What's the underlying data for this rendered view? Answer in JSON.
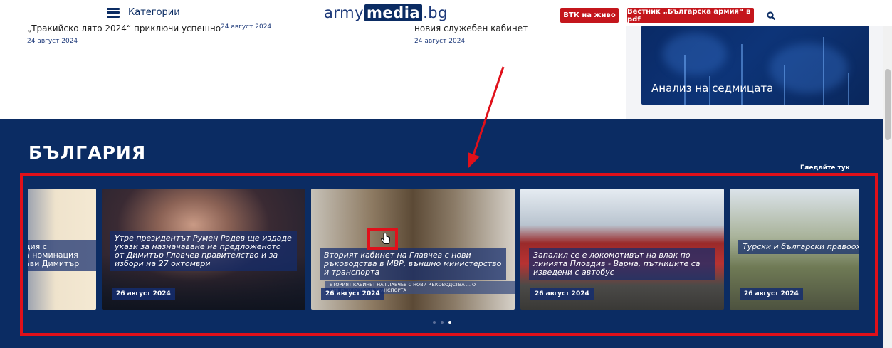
{
  "header": {
    "menu_label": "Категории",
    "logo": {
      "part1": "army",
      "part2": "media",
      "part3": ".bg"
    },
    "live_button": "ВТК на живо",
    "newspaper_button": "Вестник „Българска армия“ в pdf",
    "search_icon": "search-icon"
  },
  "previous_news": [
    {
      "title": "„Тракийско лято 2024“ приключи успешно",
      "date": "24 август 2024"
    },
    {
      "title": "",
      "date": "24 август 2024"
    },
    {
      "title": "новия служебен кабинет",
      "date": "24 август 2024"
    }
  ],
  "sidebar": {
    "weekly_label": "Анализ на седмицата"
  },
  "section": {
    "title": "БЪЛГАРИЯ",
    "see_more": "Гледайте тук",
    "cards": [
      {
        "title": "ция с\nа номинация\nави Димитър",
        "date": ""
      },
      {
        "title": "Утре президентът Румен Радев ще издаде укази за назначаване на предложеното от Димитър Главчев правителство и за избори на 27 октомври",
        "date": "26 август 2024"
      },
      {
        "title": "Вторият кабинет на Главчев с нови ръководства в МВР, външно министерство и транспорта",
        "date": "26 август 2024",
        "subtitle": "ВТОРИЯТ КАБИНЕТ НА ГЛАВЧЕВ С НОВИ РЪКОВОДСТВА ... О МИНИСТЕРСТВО И ТРАНСПОРТА"
      },
      {
        "title": "Запалил се е локомотивът на влак по линията Пловдив - Варна, пътниците са изведени с автобус",
        "date": "26 август 2024"
      },
      {
        "title": "Турски и български правоохр органи засилват сътрудниче борбата срещу нелегалната българо-турската граница",
        "date": "26 август 2024"
      }
    ]
  },
  "colors": {
    "navy": "#0b2c63",
    "red": "#c4161c",
    "annotation": "#e0101a"
  }
}
